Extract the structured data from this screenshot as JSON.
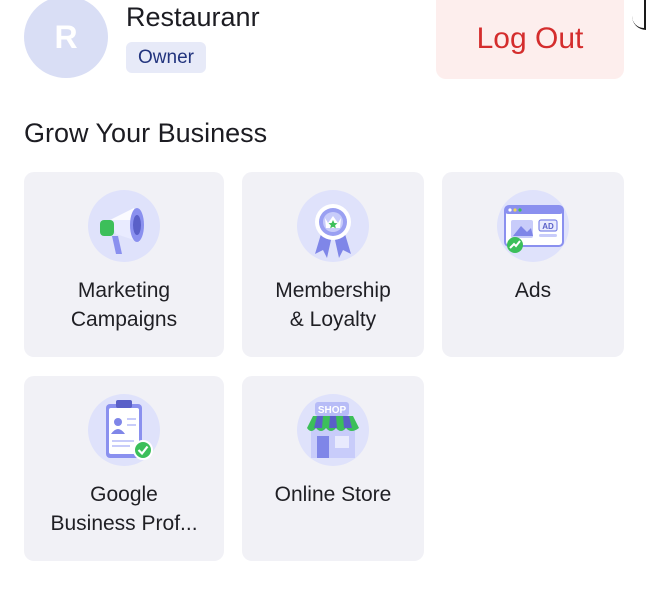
{
  "profile": {
    "avatar_initial": "R",
    "name": "Restauranr",
    "role": "Owner"
  },
  "logout_label": "Log Out",
  "section": {
    "title": "Grow Your Business"
  },
  "features": [
    {
      "line1": "Marketing",
      "line2": "Campaigns",
      "icon": "megaphone-icon"
    },
    {
      "line1": "Membership",
      "line2": "& Loyalty",
      "icon": "award-badge-icon"
    },
    {
      "line1": "Ads",
      "line2": "",
      "icon": "ad-browser-icon"
    },
    {
      "line1": "Google",
      "line2": "Business Prof...",
      "icon": "clipboard-profile-icon"
    },
    {
      "line1": "Online Store",
      "line2": "",
      "icon": "shop-icon",
      "icon_text": "SHOP"
    }
  ],
  "colors": {
    "accent_red": "#d42d2d",
    "logout_bg": "#fdeeed",
    "card_bg": "#f1f1f6",
    "avatar_bg": "#d9def5",
    "icon_green": "#3cbf5a",
    "icon_purple": "#7f86e8"
  }
}
